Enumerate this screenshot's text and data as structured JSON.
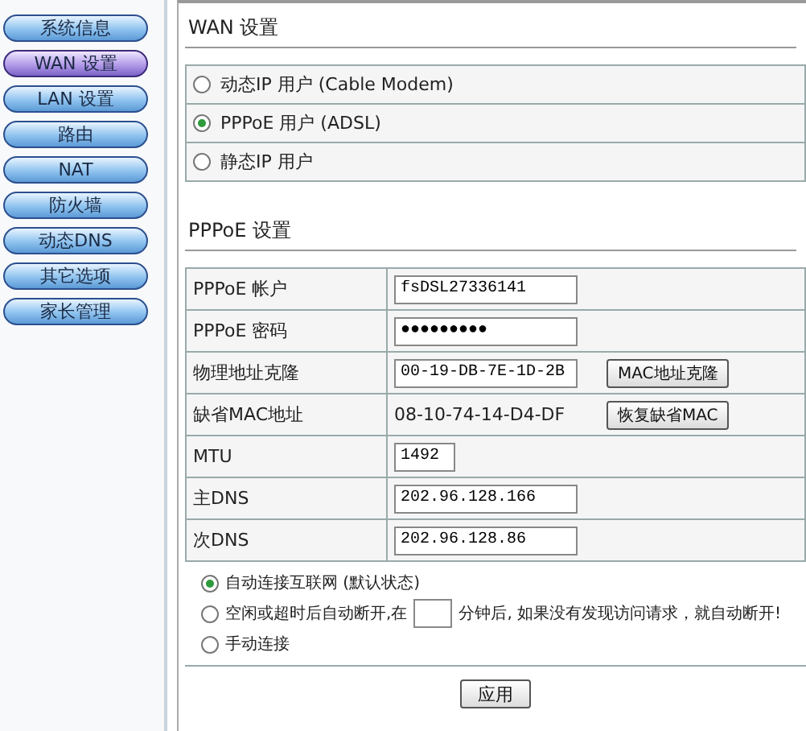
{
  "sidebar": {
    "items": [
      {
        "label": "系统信息",
        "selected": false
      },
      {
        "label": "WAN 设置",
        "selected": true
      },
      {
        "label": "LAN 设置",
        "selected": false
      },
      {
        "label": "路由",
        "selected": false
      },
      {
        "label": "NAT",
        "selected": false
      },
      {
        "label": "防火墙",
        "selected": false
      },
      {
        "label": "动态DNS",
        "selected": false
      },
      {
        "label": "其它选项",
        "selected": false
      },
      {
        "label": "家长管理",
        "selected": false
      }
    ]
  },
  "wan": {
    "title": "WAN 设置",
    "modes": [
      {
        "label": "动态IP 用户  (Cable Modem)",
        "selected": false
      },
      {
        "label": "PPPoE 用户  (ADSL)",
        "selected": true
      },
      {
        "label": "静态IP 用户",
        "selected": false
      }
    ]
  },
  "pppoe": {
    "title": "PPPoE 设置",
    "rows": [
      {
        "kind": "input",
        "label": "PPPoE 帐户",
        "value": "fsDSL27336141"
      },
      {
        "kind": "password",
        "label": "PPPoE 密码",
        "value": "●●●●●●●●●"
      },
      {
        "kind": "input_button",
        "label": "物理地址克隆",
        "value": "00-19-DB-7E-1D-2B",
        "button": "MAC地址克隆"
      },
      {
        "kind": "text_button",
        "label": "缺省MAC地址",
        "value": "08-10-74-14-D4-DF",
        "button": "恢复缺省MAC"
      },
      {
        "kind": "short_input",
        "label": "MTU",
        "value": "1492"
      },
      {
        "kind": "input",
        "label": "主DNS",
        "value": "202.96.128.166"
      },
      {
        "kind": "input",
        "label": "次DNS",
        "value": "202.96.128.86"
      }
    ],
    "connect_modes": [
      {
        "kind": "plain",
        "label": "自动连接互联网 (默认状态)",
        "selected": true
      },
      {
        "kind": "timeout",
        "label": "空闲或超时后自动断开,在",
        "suffix": "分钟后, 如果没有发现访问请求，就自动断开!",
        "selected": false
      },
      {
        "kind": "plain",
        "label": "手动连接",
        "selected": false
      }
    ]
  },
  "apply_button": "应用"
}
